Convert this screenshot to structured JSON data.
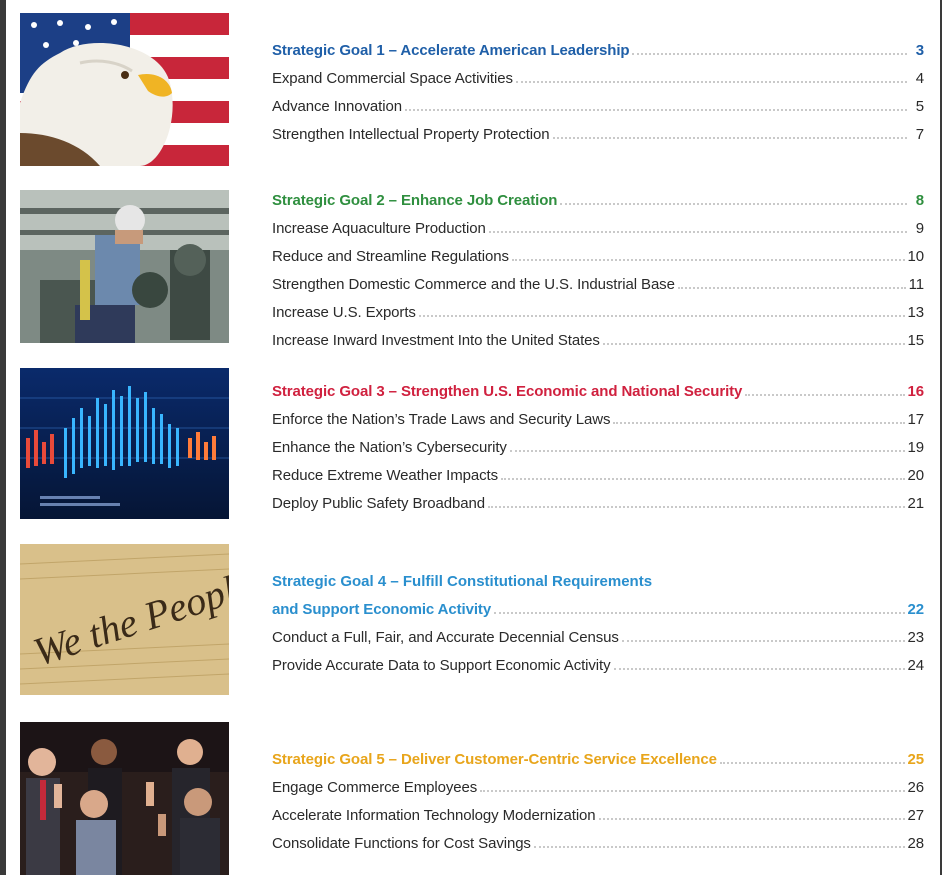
{
  "goals": [
    {
      "title": "Strategic Goal 1 – Accelerate American Leadership",
      "page": "3",
      "items": [
        {
          "label": "Expand Commercial Space Activities",
          "page": "4"
        },
        {
          "label": "Advance Innovation",
          "page": "5"
        },
        {
          "label": "Strengthen Intellectual Property Protection",
          "page": "7"
        }
      ],
      "image": "bald-eagle-american-flag",
      "color": "#1f5fa8"
    },
    {
      "title": "Strategic Goal 2 – Enhance Job Creation",
      "page": "8",
      "items": [
        {
          "label": "Increase Aquaculture Production",
          "page": "9"
        },
        {
          "label": "Reduce and Streamline Regulations",
          "page": "10"
        },
        {
          "label": "Strengthen Domestic Commerce and the U.S. Industrial Base",
          "page": "11"
        },
        {
          "label": "Increase U.S. Exports",
          "page": "13"
        },
        {
          "label": "Increase Inward Investment Into the United States",
          "page": "15"
        }
      ],
      "image": "industrial-worker-hard-hat",
      "color": "#2f8f3f"
    },
    {
      "title": "Strategic Goal 3 – Strengthen U.S. Economic and National Security",
      "page": "16",
      "items": [
        {
          "label": "Enforce the Nation’s Trade Laws and Security Laws",
          "page": "17"
        },
        {
          "label": "Enhance the Nation’s Cybersecurity",
          "page": "19"
        },
        {
          "label": "Reduce Extreme Weather Impacts",
          "page": "20"
        },
        {
          "label": "Deploy Public Safety Broadband",
          "page": "21"
        }
      ],
      "image": "stock-market-data-chart",
      "color": "#d0213f"
    },
    {
      "title_line1": "Strategic Goal 4 – Fulfill Constitutional Requirements",
      "title_line2": "and Support Economic Activity",
      "page": "22",
      "items": [
        {
          "label": "Conduct a Full, Fair, and Accurate Decennial Census",
          "page": "23"
        },
        {
          "label": "Provide Accurate Data to Support Economic Activity",
          "page": "24"
        }
      ],
      "image": "we-the-people-constitution",
      "image_text": "We the People",
      "color": "#2a8fce"
    },
    {
      "title": "Strategic Goal 5 – Deliver Customer-Centric Service Excellence",
      "page": "25",
      "items": [
        {
          "label": "Engage Commerce Employees",
          "page": "26"
        },
        {
          "label": "Accelerate Information Technology Modernization",
          "page": "27"
        },
        {
          "label": "Consolidate Functions for Cost Savings",
          "page": "28"
        }
      ],
      "image": "employees-taking-oath",
      "color": "#e8a51b"
    }
  ]
}
